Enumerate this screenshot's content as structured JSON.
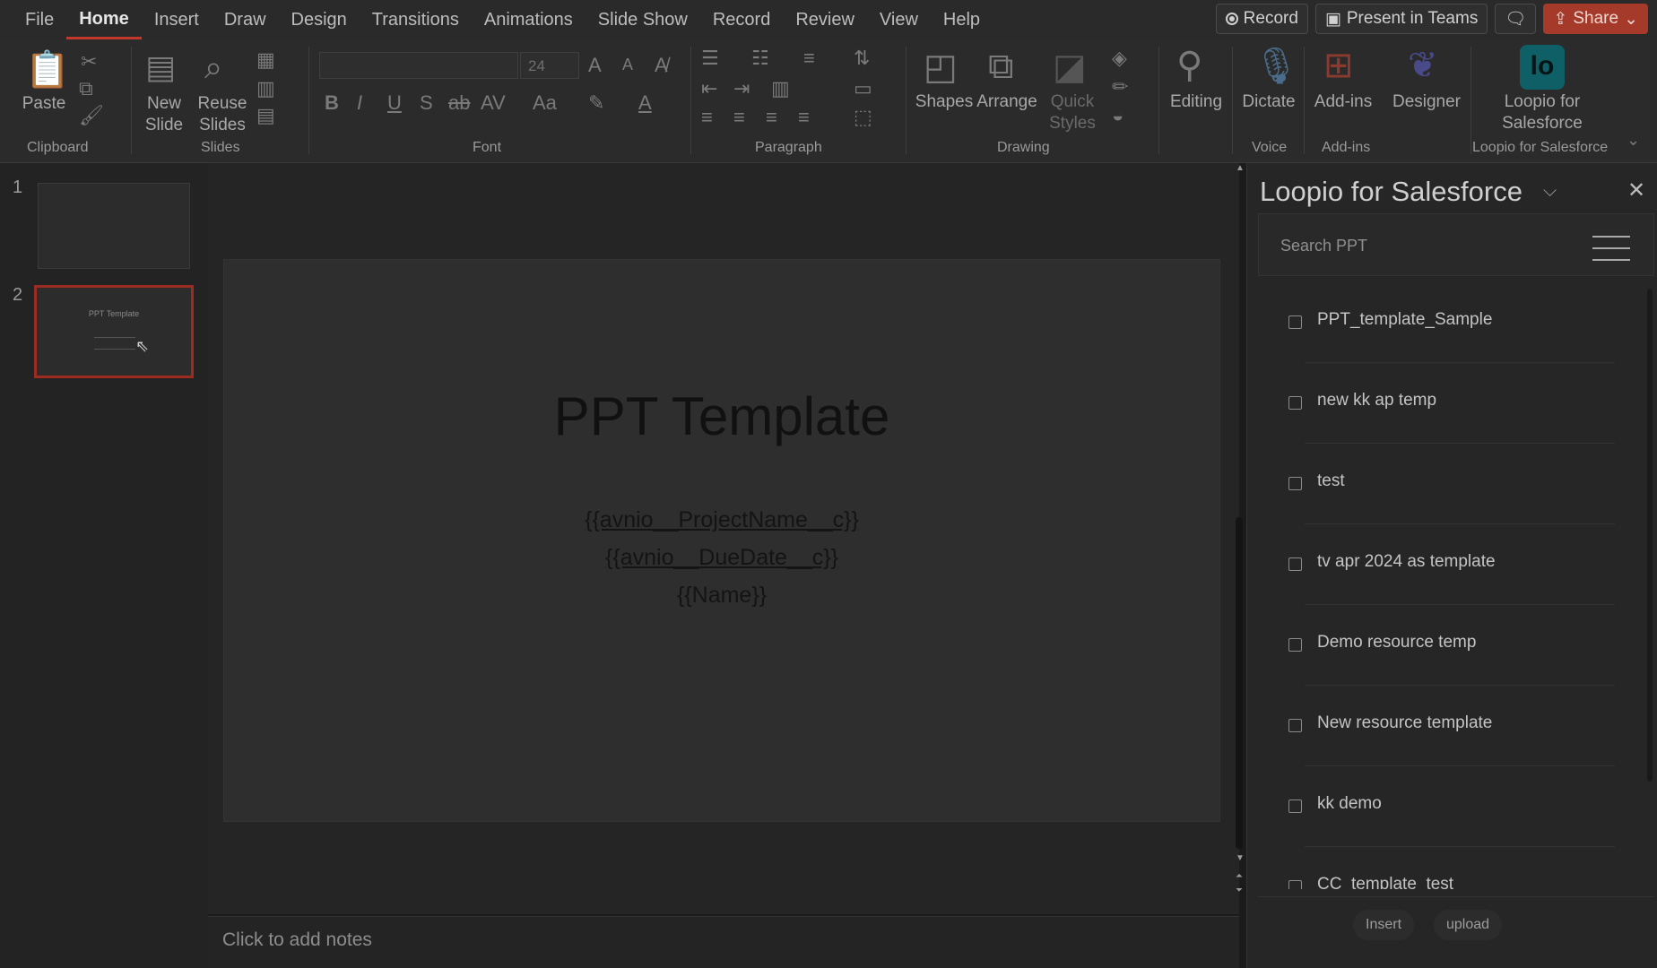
{
  "menubar": {
    "items": [
      "File",
      "Home",
      "Insert",
      "Draw",
      "Design",
      "Transitions",
      "Animations",
      "Slide Show",
      "Record",
      "Review",
      "View",
      "Help"
    ],
    "active": "Home",
    "record_label": "Record",
    "present_label": "Present in Teams",
    "share_label": "Share"
  },
  "ribbon": {
    "groups": {
      "clipboard": "Clipboard",
      "slides": "Slides",
      "font": "Font",
      "paragraph": "Paragraph",
      "drawing": "Drawing",
      "voice": "Voice",
      "addins": "Add-ins",
      "loopio": "Loopio for Salesforce"
    },
    "paste": "Paste",
    "new_slide": "New Slide",
    "reuse_slides": "Reuse Slides",
    "font_size": "24",
    "shapes": "Shapes",
    "arrange": "Arrange",
    "quick_styles": "Quick Styles",
    "editing": "Editing",
    "dictate": "Dictate",
    "addins": "Add-ins",
    "designer": "Designer",
    "loopio": "Loopio for Salesforce"
  },
  "thumbnails": [
    {
      "number": "1",
      "title": ""
    },
    {
      "number": "2",
      "title": "PPT Template"
    }
  ],
  "slide": {
    "title": "PPT Template",
    "lines": [
      "{{avnio__ProjectName__c}}",
      "{{avnio__DueDate__c}}",
      "{{Name}}"
    ]
  },
  "notes": {
    "placeholder": "Click to add notes"
  },
  "taskpane": {
    "title": "Loopio for Salesforce",
    "search_placeholder": "Search PPT",
    "items": [
      "PPT_template_Sample",
      "new kk ap temp",
      "test",
      "tv apr 2024 as template",
      "Demo resource temp",
      "New resource template",
      "kk demo",
      "CC_template_test"
    ],
    "insert_label": "Insert",
    "upload_label": "upload"
  }
}
